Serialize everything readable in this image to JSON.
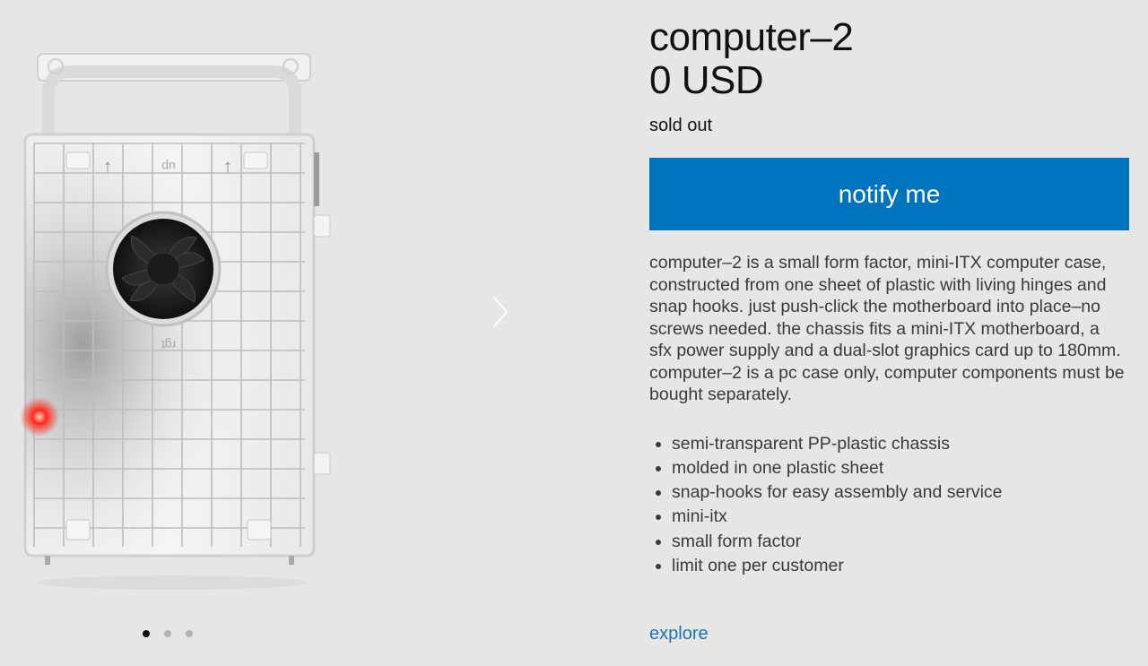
{
  "product": {
    "title": "computer–2",
    "price": "0 USD",
    "stock_status": "sold out",
    "notify_label": "notify me",
    "description": "computer–2 is a small form factor, mini-ITX computer case, constructed from one sheet of plastic with living hinges and snap hooks. just push-click the motherboard into place–no screws needed. the chassis fits a mini-ITX motherboard, a sfx power supply and a dual-slot graphics card up to 180mm. computer–2 is a pc case only, computer components must be bought separately.",
    "features": [
      "semi-transparent PP-plastic chassis",
      "molded in one plastic sheet",
      "snap-hooks for easy assembly and service",
      "mini-itx",
      "small form factor",
      "limit one per customer"
    ],
    "explore_label": "explore"
  },
  "gallery": {
    "slide_count": 3,
    "active_slide": 1,
    "case_labels": {
      "top": "up",
      "middle": "rgt"
    }
  },
  "colors": {
    "accent": "#0073bf",
    "link": "#1a74b8",
    "background": "#e6e6e6",
    "indicator_light": "#ff2a1a"
  }
}
